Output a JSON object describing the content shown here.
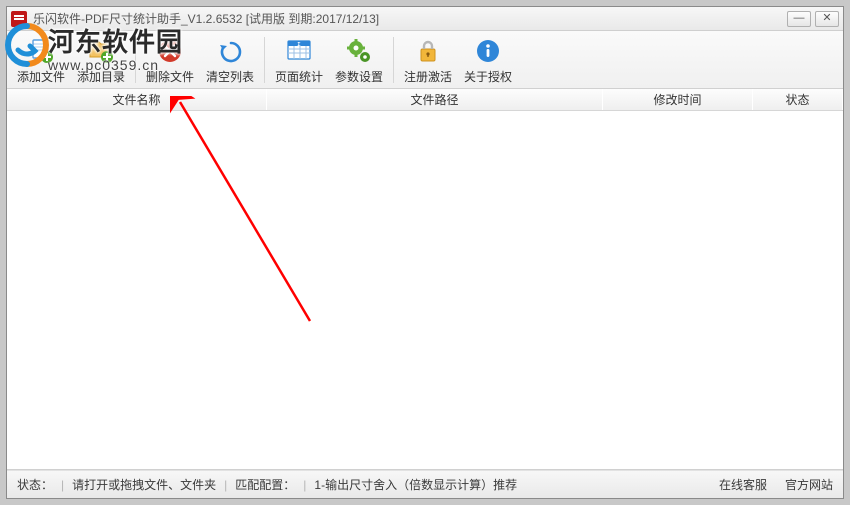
{
  "title": "乐闪软件-PDF尺寸统计助手_V1.2.6532 [试用版 到期:2017/12/13]",
  "toolbar": {
    "add_file": "添加文件",
    "add_folder": "添加目录",
    "delete_file": "删除文件",
    "clear_list": "清空列表",
    "page_stats": "页面统计",
    "settings": "参数设置",
    "register": "注册激活",
    "about": "关于授权"
  },
  "columns": {
    "name": "文件名称",
    "path": "文件路径",
    "mtime": "修改时间",
    "status": "状态"
  },
  "status": {
    "label": "状态：",
    "hint": "请打开或拖拽文件、文件夹",
    "match_label": "匹配配置：",
    "match_value": "1-输出尺寸舍入（倍数显示计算）推荐",
    "online_service": "在线客服",
    "official_site": "官方网站"
  },
  "watermark": {
    "site_name": "河东软件园",
    "url": "www.pc0359.cn"
  },
  "colors": {
    "accent_blue": "#2f86d8",
    "accent_green": "#4fa628",
    "accent_orange": "#e98b14",
    "accent_red": "#d23a2a"
  }
}
